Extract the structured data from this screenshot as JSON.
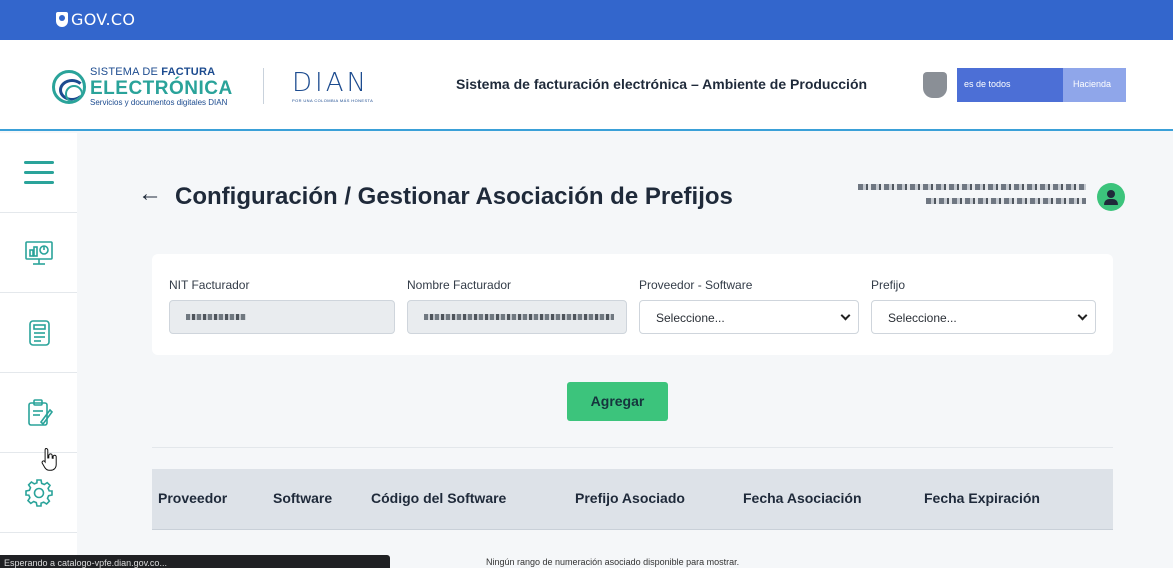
{
  "gov_bar": {
    "logo_text": "GOV.CO"
  },
  "header": {
    "brand_line1_prefix": "SISTEMA DE ",
    "brand_line1_bold": "FACTURA",
    "brand_line2": "ELECTRÓNICA",
    "brand_line3": "Servicios y documentos digitales DIAN",
    "dian_word": "DIAN",
    "dian_tagline": "POR UNA COLOMBIA MÁS HONESTA",
    "environment_title": "Sistema de facturación electrónica – Ambiente de Producción",
    "hacienda_text_1": "es de todos",
    "hacienda_text_2": "Hacienda"
  },
  "sidebar": {
    "items": [
      {
        "icon": "hamburger-menu-icon"
      },
      {
        "icon": "dashboard-monitor-icon"
      },
      {
        "icon": "document-list-icon"
      },
      {
        "icon": "clipboard-edit-icon"
      },
      {
        "icon": "gear-icon"
      }
    ]
  },
  "page": {
    "back_icon": "←",
    "title": "Configuración / Gestionar Asociación de Prefijos"
  },
  "form": {
    "nit_label": "NIT Facturador",
    "nombre_label": "Nombre Facturador",
    "proveedor_label": "Proveedor - Software",
    "proveedor_value": "Seleccione...",
    "prefijo_label": "Prefijo",
    "prefijo_value": "Seleccione..."
  },
  "actions": {
    "add_label": "Agregar"
  },
  "table": {
    "columns": [
      "Proveedor",
      "Software",
      "Código del Software",
      "Prefijo Asociado",
      "Fecha Asociación",
      "Fecha Expiración"
    ],
    "empty_message": "Ningún rango de numeración asociado disponible para mostrar."
  },
  "status_bar": {
    "text": "Esperando a catalogo-vpfe.dian.gov.co..."
  },
  "colors": {
    "gov_blue": "#3366cc",
    "accent_green": "#3cc47c",
    "teal": "#2aa39a",
    "navy": "#1c4b8f"
  }
}
